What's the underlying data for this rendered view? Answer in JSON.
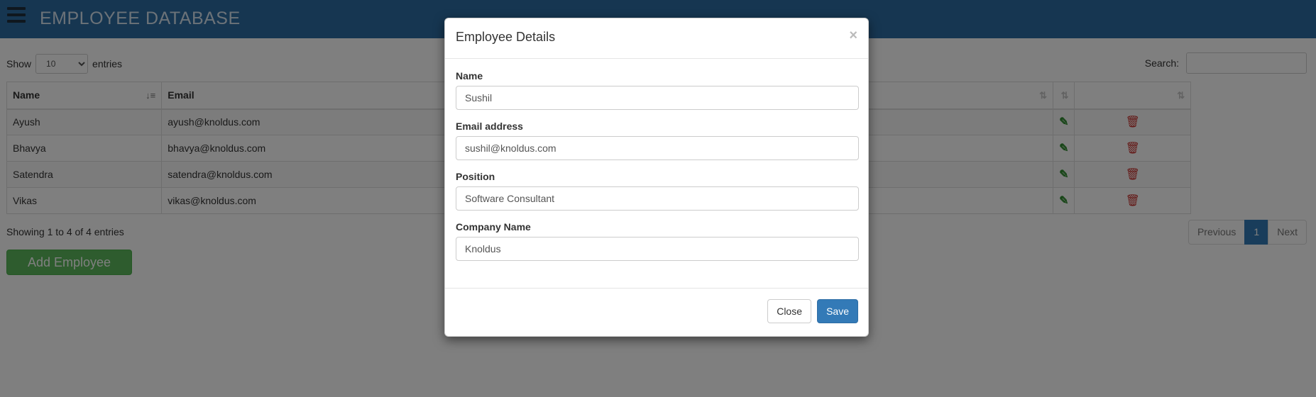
{
  "header": {
    "title": "EMPLOYEE DATABASE",
    "menu_icon": "hamburger-menu-icon",
    "background": "#2d6ca2"
  },
  "controls": {
    "show_label": "Show",
    "entries_value": "10",
    "entries_label": "entries",
    "search_label": "Search:",
    "search_value": ""
  },
  "table": {
    "columns": [
      {
        "label": "Name"
      },
      {
        "label": "Email"
      },
      {
        "label": ""
      },
      {
        "label": ""
      },
      {
        "label": ""
      }
    ],
    "rows": [
      {
        "name": "Ayush",
        "email": "ayush@knoldus.com"
      },
      {
        "name": "Bhavya",
        "email": "bhavya@knoldus.com"
      },
      {
        "name": "Satendra",
        "email": "satendra@knoldus.com"
      },
      {
        "name": "Vikas",
        "email": "vikas@knoldus.com"
      }
    ],
    "edit_icon": "edit-icon",
    "delete_icon": "trash-icon"
  },
  "footer": {
    "info": "Showing 1 to 4 of 4 entries",
    "pager": {
      "previous": "Previous",
      "current": "1",
      "next": "Next"
    },
    "add_button": "Add Employee"
  },
  "modal": {
    "title": "Employee Details",
    "close_symbol": "×",
    "fields": {
      "name": {
        "label": "Name",
        "value": "Sushil"
      },
      "email": {
        "label": "Email address",
        "value": "sushil@knoldus.com"
      },
      "position": {
        "label": "Position",
        "value": "Software Consultant"
      },
      "company": {
        "label": "Company Name",
        "value": "Knoldus"
      }
    },
    "close_button": "Close",
    "save_button": "Save"
  },
  "colors": {
    "primary": "#337ab7",
    "success": "#5cb85c",
    "danger": "#c9302c",
    "edit": "#2e8b2e"
  }
}
